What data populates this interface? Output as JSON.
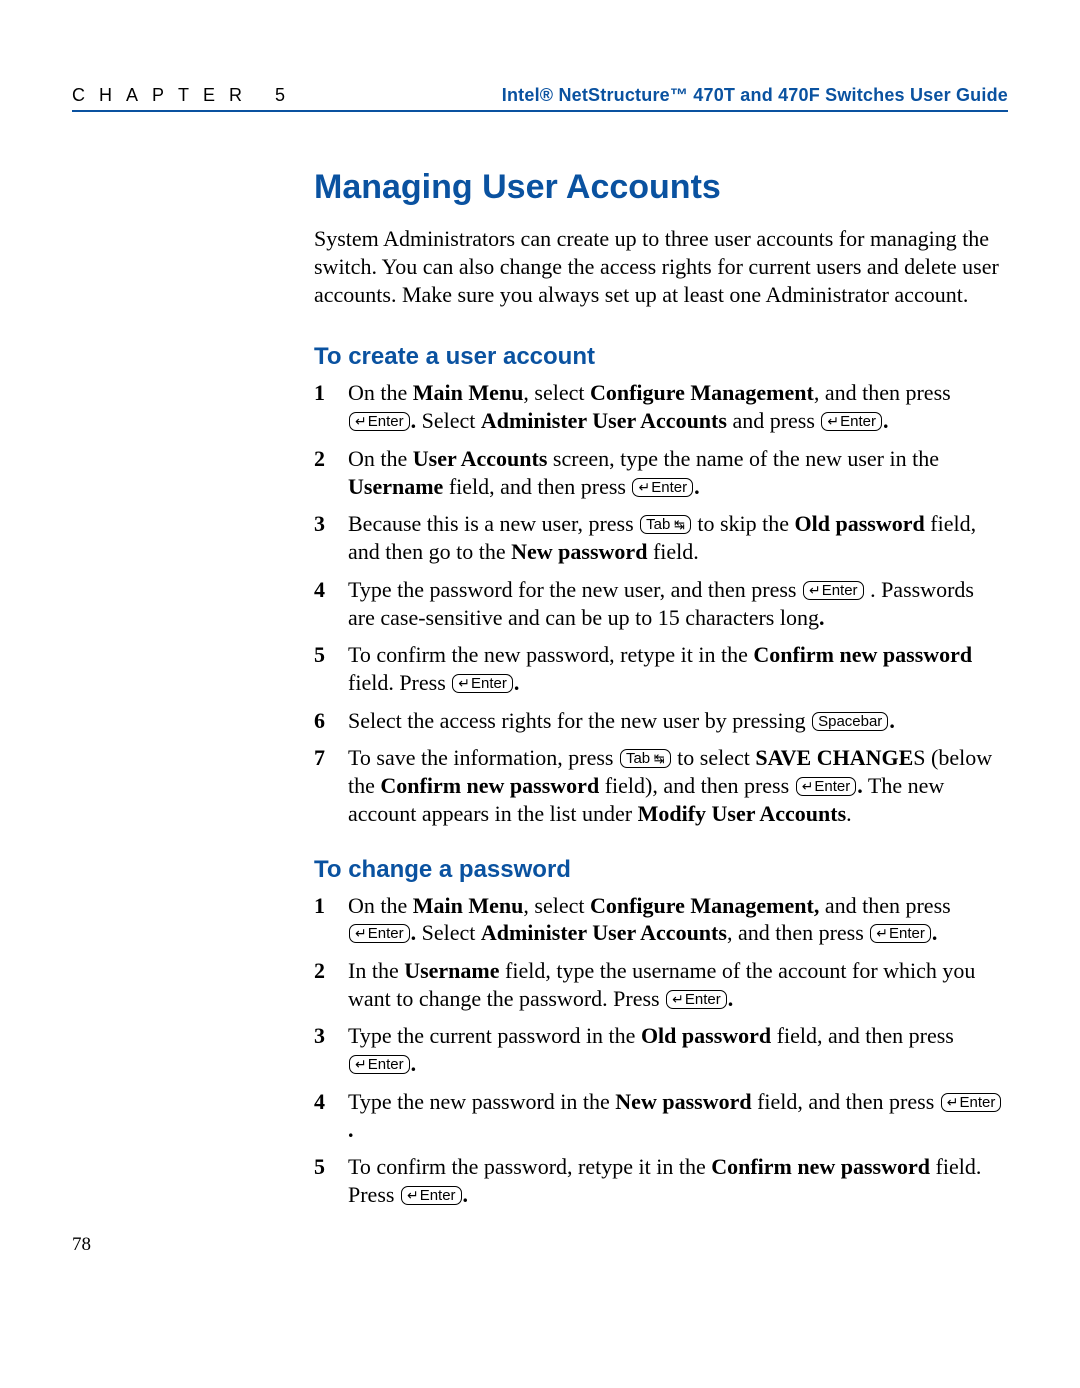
{
  "header": {
    "chapter_label": "CHAPTER 5",
    "doc_title": "Intel® NetStructure™ 470T and 470F Switches User Guide"
  },
  "page_number": "78",
  "h1": "Managing User Accounts",
  "intro": "System Administrators can create up to three user accounts for managing the switch. You can also change the access rights for current users and delete user accounts. Make sure you always set up at least one Administrator account.",
  "keys": {
    "enter": "Enter",
    "tab": "Tab",
    "spacebar": "Spacebar"
  },
  "sec1": {
    "heading": "To create a user account",
    "s1": {
      "a": "On the ",
      "b1": "Main Menu",
      "b": ", select ",
      "b2": "Configure Management",
      "c": ", and then press ",
      "d": " Select ",
      "b3": "Administer User Accounts",
      "e": " and press "
    },
    "s2": {
      "a": "On the ",
      "b1": "User Accounts",
      "b": " screen, type the name of the new user in the ",
      "b2": "Username",
      "c": " field, and then press "
    },
    "s3": {
      "a": "Because this is a new user, press ",
      "b": " to skip the ",
      "b1": "Old password",
      "c": " field, and then go to the ",
      "b2": "New password",
      "d": " field."
    },
    "s4": {
      "a": "Type the password for the new user, and then press ",
      "b": " . Passwords are case-sensitive and can be up to 15 characters long",
      "c": "."
    },
    "s5": {
      "a": "To confirm the new password, retype it in the ",
      "b1": "Confirm new password",
      "b": " field. Press "
    },
    "s6": {
      "a": "Select the access rights for the new user by pressing "
    },
    "s7": {
      "a": "To save the information, press ",
      "b": " to select ",
      "b1": "SAVE CHANGE",
      "b1s": "S",
      "c": " (below the ",
      "b2": "Confirm new password",
      "d": " field), and then press ",
      "e": " The new account appears in the list under ",
      "b3": "Modify User Accounts",
      "f": "."
    }
  },
  "sec2": {
    "heading": "To change a password",
    "s1": {
      "a": "On the ",
      "b1": "Main Menu",
      "b": ", select ",
      "b2": "Configure Management,",
      "c": " and then press ",
      "d": " Select ",
      "b3": "Administer User Accounts",
      "e": ", and then press "
    },
    "s2": {
      "a": "In the ",
      "b1": "Username",
      "b": " field, type the username of the account for which you want to change the password. Press "
    },
    "s3": {
      "a": "Type the current password in the ",
      "b1": "Old password",
      "b": " field, and then press "
    },
    "s4": {
      "a": "Type the new password in the ",
      "b1": "New password",
      "b": " field, and then press "
    },
    "s5": {
      "a": "To confirm the password, retype it in the ",
      "b1": "Confirm new password",
      "b": " field. Press "
    }
  }
}
